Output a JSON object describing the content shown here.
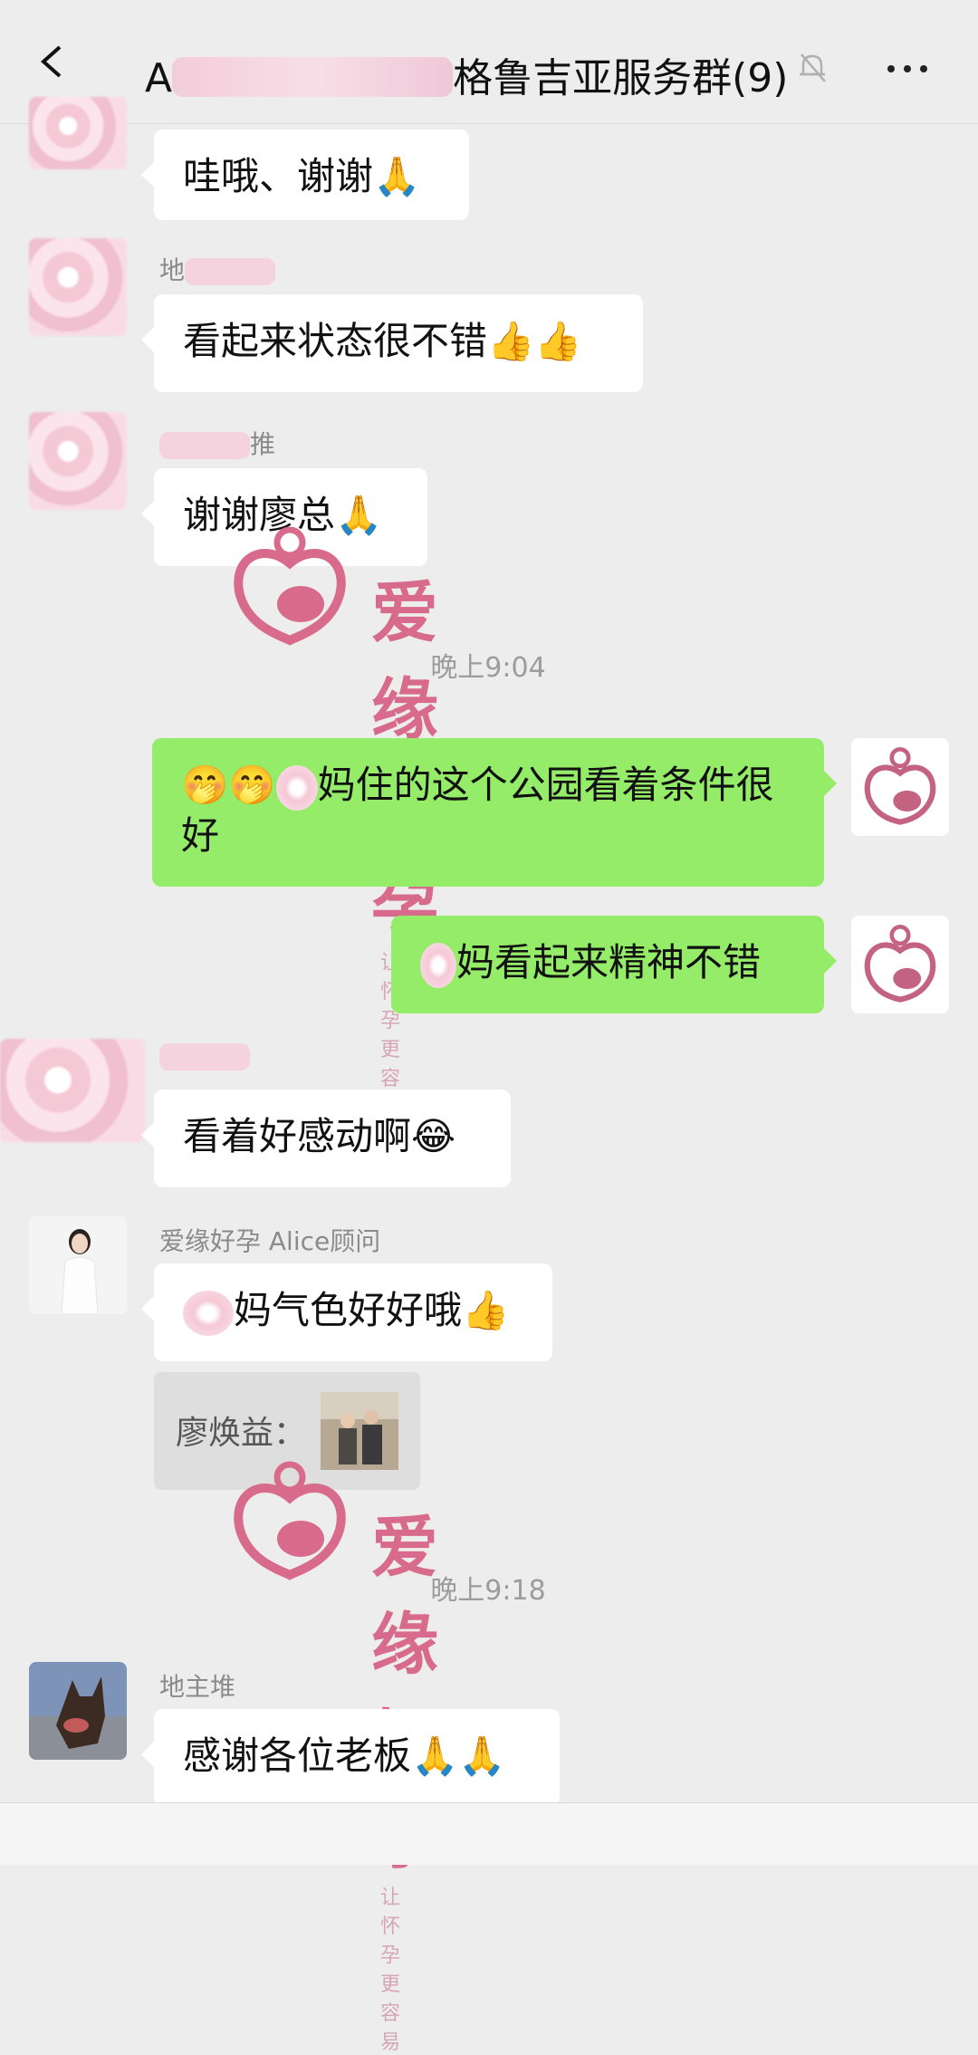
{
  "header": {
    "title_prefix": "A",
    "title_main": "格鲁吉亚服务群(9)"
  },
  "messages": [
    {
      "text": "哇哦、谢谢🙏"
    },
    {
      "name": "地",
      "text": "看起来状态很不错👍👍"
    },
    {
      "name": "推",
      "text": "谢谢廖总🙏"
    },
    {
      "text": "🤭🤭",
      "text2": "妈住的这个公园看着条件很好"
    },
    {
      "text": "妈看起来精神不错"
    },
    {
      "text": "看着好感动啊😂"
    },
    {
      "name": "爱缘好孕 Alice顾问",
      "text": "妈气色好好哦👍"
    },
    {
      "name": "廖焕益："
    },
    {
      "name": "地主堆",
      "text": "感谢各位老板🙏🙏"
    }
  ],
  "times": [
    "晚上9:04",
    "晚上9:18"
  ],
  "watermark": {
    "brand": "爱缘好孕",
    "slogan": "让怀孕更容易"
  },
  "colors": {
    "green_bubble": "#95ec69",
    "brand_pink": "#d86b8c"
  }
}
